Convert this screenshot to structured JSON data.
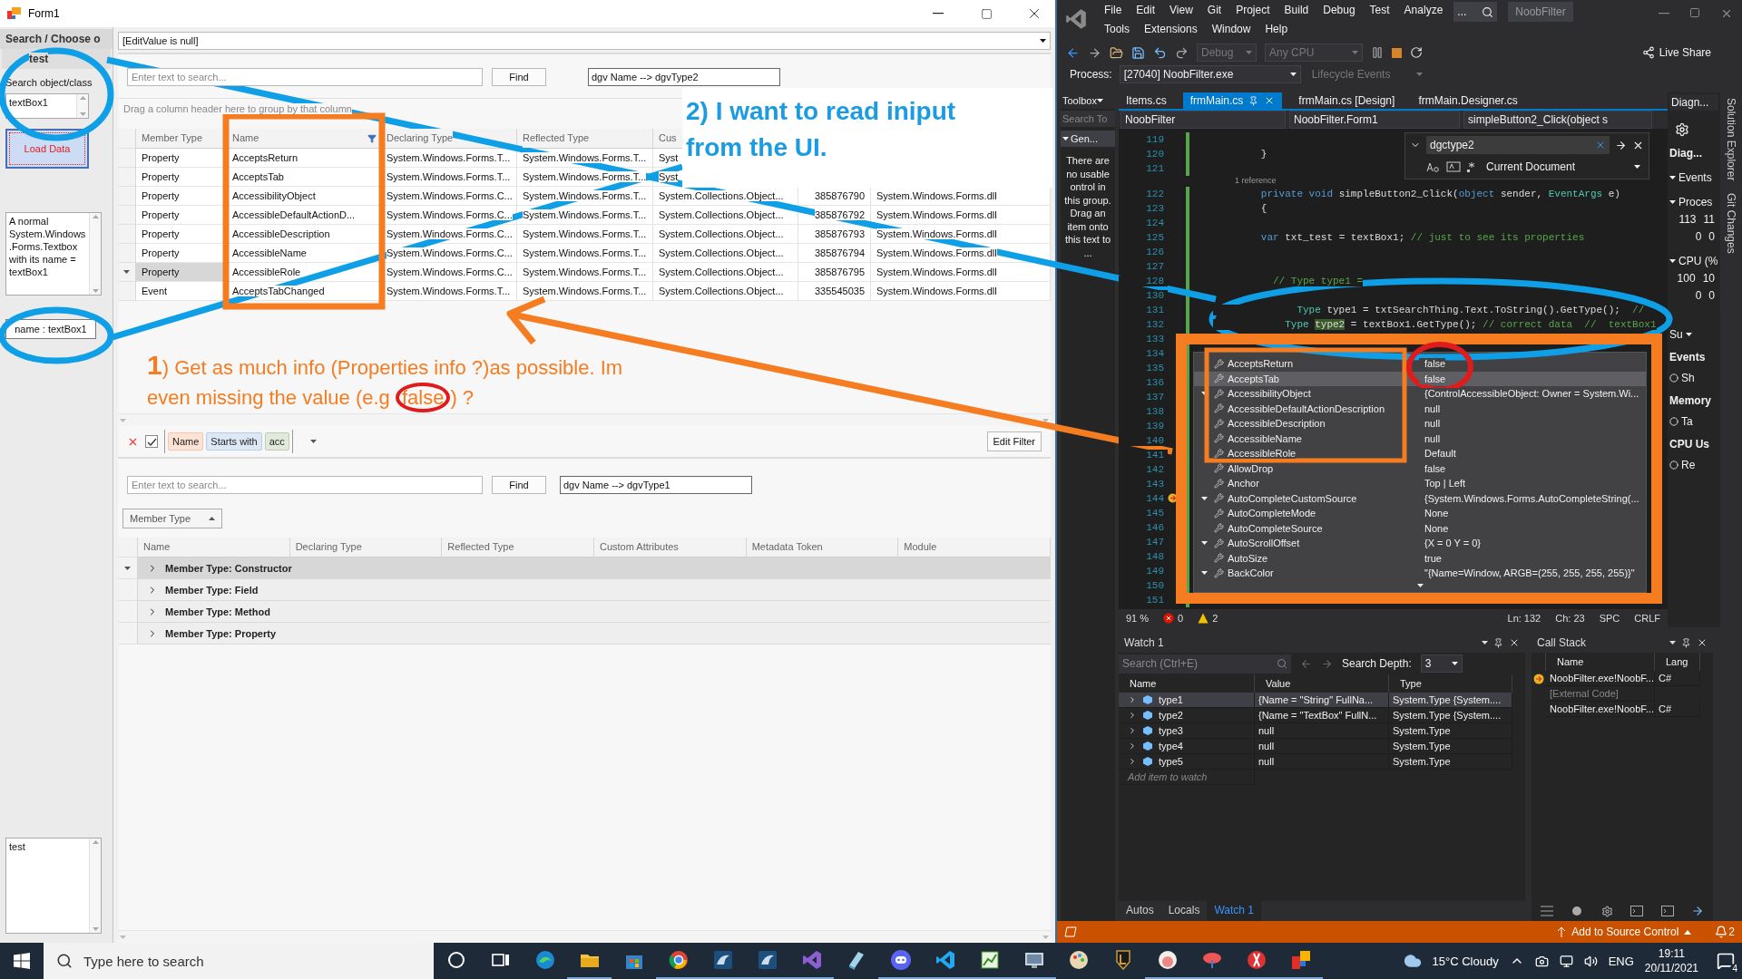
{
  "form": {
    "title": "Form1",
    "sidebar": {
      "header": "Search / Choose o",
      "group": "test",
      "search_label": "Search object/class",
      "search_value": "textBox1",
      "load_button": "Load Data",
      "description": "A normal System.Windows .Forms.Textbox with its name = textBox1",
      "name_field": "name : textBox1",
      "notes": "test"
    },
    "edit_value": "[EditValue is null]",
    "top": {
      "search_placeholder": "Enter text to search...",
      "find": "Find",
      "dgv_label": "dgv Name --> dgvType2",
      "group_panel": "Drag a column header here to group by that column",
      "columns": [
        {
          "label": "Member Type",
          "filtered": false
        },
        {
          "label": "Name",
          "filtered": true
        },
        {
          "label": "Declaring Type",
          "filtered": false
        },
        {
          "label": "Reflected Type",
          "filtered": false
        },
        {
          "label": "Cus"
        }
      ],
      "rows": [
        {
          "member_type": "Property",
          "name": "AcceptsReturn",
          "declaring_type": "System.Windows.Forms.T...",
          "reflected_type": "System.Windows.Forms.T...",
          "custom_attributes": "Syst",
          "selected": false
        },
        {
          "member_type": "Property",
          "name": "AcceptsTab",
          "declaring_type": "System.Windows.Forms.T...",
          "reflected_type": "System.Windows.Forms.T...",
          "custom_attributes": "Syst",
          "selected": false
        },
        {
          "member_type": "Property",
          "name": "AccessibilityObject",
          "declaring_type": "System.Windows.Forms.C...",
          "reflected_type": "System.Windows.Forms.T...",
          "custom_attributes": "System.Collections.Object...",
          "metadata_token": "385876790",
          "module": "System.Windows.Forms.dll",
          "selected": false
        },
        {
          "member_type": "Property",
          "name": "AccessibleDefaultActionD...",
          "declaring_type": "System.Windows.Forms.C...",
          "reflected_type": "System.Windows.Forms.T...",
          "custom_attributes": "System.Collections.Object...",
          "metadata_token": "385876792",
          "module": "System.Windows.Forms.dll",
          "selected": false
        },
        {
          "member_type": "Property",
          "name": "AccessibleDescription",
          "declaring_type": "System.Windows.Forms.C...",
          "reflected_type": "System.Windows.Forms.T...",
          "custom_attributes": "System.Collections.Object...",
          "metadata_token": "385876793",
          "module": "System.Windows.Forms.dll",
          "selected": false
        },
        {
          "member_type": "Property",
          "name": "AccessibleName",
          "declaring_type": "System.Windows.Forms.C...",
          "reflected_type": "System.Windows.Forms.T...",
          "custom_attributes": "System.Collections.Object...",
          "metadata_token": "385876794",
          "module": "System.Windows.Forms.dll",
          "selected": false
        },
        {
          "member_type": "Property",
          "name": "AccessibleRole",
          "declaring_type": "System.Windows.Forms.C...",
          "reflected_type": "System.Windows.Forms.T...",
          "custom_attributes": "System.Collections.Object...",
          "metadata_token": "385876795",
          "module": "System.Windows.Forms.dll",
          "selected": true
        },
        {
          "member_type": "Event",
          "name": "AcceptsTabChanged",
          "declaring_type": "System.Windows.Forms.T...",
          "reflected_type": "System.Windows.Forms.T...",
          "custom_attributes": "System.Collections.Object...",
          "metadata_token": "335545035",
          "module": "System.Windows.Forms.dll",
          "selected": false
        }
      ]
    },
    "filter": {
      "enabled": true,
      "field": "Name",
      "operator": "Starts with",
      "value": "acc",
      "edit_button": "Edit Filter"
    },
    "bottom": {
      "search_placeholder": "Enter text to search...",
      "find": "Find",
      "dgv_label": "dgv Name --> dgvType1",
      "group_chip": "Member Type",
      "columns": [
        "Name",
        "Declaring Type",
        "Reflected Type",
        "Custom Attributes",
        "Metadata Token",
        "Module"
      ],
      "groups": [
        {
          "label": "Member Type: Constructor",
          "selected": true
        },
        {
          "label": "Member Type: Field",
          "selected": false
        },
        {
          "label": "Member Type: Method",
          "selected": false
        },
        {
          "label": "Member Type: Property",
          "selected": false
        }
      ]
    }
  },
  "ide": {
    "menu": [
      [
        "File",
        "Edit",
        "View",
        "Git",
        "Project",
        "Build",
        "Debug",
        "Test",
        "Analyze"
      ],
      [
        "Tools",
        "Extensions",
        "Window",
        "Help"
      ]
    ],
    "search": "...",
    "solution": "NoobFilter",
    "config": "Debug",
    "platform": "Any CPU",
    "live_share": "Live Share",
    "process_label": "Process:",
    "process": "[27040] NoobFilter.exe",
    "lifecycle": "Lifecycle Events",
    "toolbox": {
      "title": "Toolbox",
      "search": "Search To",
      "group": "Gen...",
      "message": "There are no usable ontrol in this group. Drag an item onto this text to ..."
    },
    "tabs": [
      {
        "label": "Items.cs",
        "selected": false
      },
      {
        "label": "frmMain.cs",
        "selected": true
      },
      {
        "label": "frmMain.cs [Design]",
        "selected": false
      },
      {
        "label": "frmMain.Designer.cs",
        "selected": false
      }
    ],
    "nav": [
      "NoobFilter",
      "NoobFilter.Form1",
      "simpleButton2_Click(object s"
    ],
    "find": {
      "value": "dgctype2",
      "scope": "Current Document"
    },
    "code": [
      {
        "kind": "line",
        "number": "119",
        "bp": false
      },
      {
        "kind": "line",
        "number": "120",
        "bp": false,
        "segments": [
          {
            "kind": "plain",
            "text": "        }"
          }
        ]
      },
      {
        "kind": "line",
        "number": "121",
        "bp": false
      },
      {
        "kind": "codelens",
        "text": "1 reference"
      },
      {
        "kind": "line",
        "number": "122",
        "bp": false,
        "segments": [
          {
            "kind": "kw",
            "text": "        private void "
          },
          {
            "kind": "plain",
            "text": "simpleButton2_Click("
          },
          {
            "kind": "kw",
            "text": "object "
          },
          {
            "kind": "plain",
            "text": "sender, "
          },
          {
            "kind": "type",
            "text": "EventArgs "
          },
          {
            "kind": "plain",
            "text": "e)"
          }
        ]
      },
      {
        "kind": "line",
        "number": "123",
        "bp": false,
        "segments": [
          {
            "kind": "plain",
            "text": "        {"
          }
        ]
      },
      {
        "kind": "line",
        "number": "124",
        "bp": false
      },
      {
        "kind": "line",
        "number": "125",
        "bp": false,
        "segments": [
          {
            "kind": "kw",
            "text": "        var "
          },
          {
            "kind": "plain",
            "text": "txt_test = textBox1; "
          },
          {
            "kind": "comment",
            "text": "// just to see its properties"
          }
        ]
      },
      {
        "kind": "line",
        "number": "126",
        "bp": false
      },
      {
        "kind": "line",
        "number": "127",
        "bp": false
      },
      {
        "kind": "line",
        "number": "128",
        "bp": false,
        "segments": [
          {
            "kind": "comment",
            "text": "          // Type type1 ="
          }
        ]
      },
      {
        "kind": "line",
        "number": "130",
        "bp": false
      },
      {
        "kind": "line",
        "number": "131",
        "bp": false,
        "segments": [
          {
            "kind": "type",
            "text": "              Type "
          },
          {
            "kind": "plain",
            "text": "type1 = txtSearchThing.Text.ToString().GetType();  "
          },
          {
            "kind": "comment",
            "text": "//"
          }
        ]
      },
      {
        "kind": "line",
        "number": "132",
        "bp": false,
        "segments": [
          {
            "kind": "type",
            "text": "            Type "
          },
          {
            "kind": "hl",
            "text": "type2"
          },
          {
            "kind": "plain",
            "text": " = textBox1.GetType(); "
          },
          {
            "kind": "comment",
            "text": "// correct data  //  textBox1"
          }
        ]
      },
      {
        "kind": "line",
        "number": "133",
        "bp": false
      },
      {
        "kind": "line",
        "number": "134",
        "bp": false
      },
      {
        "kind": "line",
        "number": "135",
        "bp": false
      },
      {
        "kind": "line",
        "number": "136",
        "bp": false
      },
      {
        "kind": "line",
        "number": "137",
        "bp": false
      },
      {
        "kind": "line",
        "number": "138",
        "bp": false
      },
      {
        "kind": "line",
        "number": "139",
        "bp": false
      },
      {
        "kind": "line",
        "number": "140",
        "bp": false
      },
      {
        "kind": "line",
        "number": "141",
        "bp": false
      },
      {
        "kind": "line",
        "number": "142",
        "bp": false
      },
      {
        "kind": "line",
        "number": "143",
        "bp": false
      },
      {
        "kind": "line",
        "number": "144",
        "bp": true
      },
      {
        "kind": "line",
        "number": "145",
        "bp": false
      },
      {
        "kind": "line",
        "number": "146",
        "bp": false
      },
      {
        "kind": "line",
        "number": "147",
        "bp": false
      },
      {
        "kind": "line",
        "number": "148",
        "bp": false
      },
      {
        "kind": "line",
        "number": "149",
        "bp": false
      },
      {
        "kind": "line",
        "number": "150",
        "bp": false
      },
      {
        "kind": "line",
        "number": "151",
        "bp": false
      }
    ],
    "datatip": [
      {
        "name": "AcceptsReturn",
        "value": "false",
        "expandable": false,
        "selected": false
      },
      {
        "name": "AcceptsTab",
        "value": "false",
        "expandable": false,
        "selected": true
      },
      {
        "name": "AccessibilityObject",
        "value": "{ControlAccessibleObject: Owner = System.Wi...",
        "expandable": true,
        "selected": false
      },
      {
        "name": "AccessibleDefaultActionDescription",
        "value": "null",
        "expandable": false,
        "selected": false
      },
      {
        "name": "AccessibleDescription",
        "value": "null",
        "expandable": false,
        "selected": false
      },
      {
        "name": "AccessibleName",
        "value": "null",
        "expandable": false,
        "selected": false
      },
      {
        "name": "AccessibleRole",
        "value": "Default",
        "expandable": false,
        "selected": false
      },
      {
        "name": "AllowDrop",
        "value": "false",
        "expandable": false,
        "selected": false
      },
      {
        "name": "Anchor",
        "value": "Top | Left",
        "expandable": false,
        "selected": false
      },
      {
        "name": "AutoCompleteCustomSource",
        "value": "{System.Windows.Forms.AutoCompleteString(...",
        "expandable": true,
        "selected": false
      },
      {
        "name": "AutoCompleteMode",
        "value": "None",
        "expandable": false,
        "selected": false
      },
      {
        "name": "AutoCompleteSource",
        "value": "None",
        "expandable": false,
        "selected": false
      },
      {
        "name": "AutoScrollOffset",
        "value": "{X = 0 Y = 0}",
        "expandable": true,
        "selected": false
      },
      {
        "name": "AutoSize",
        "value": "true",
        "expandable": false,
        "selected": false
      },
      {
        "name": "BackColor",
        "value": "\"{Name=Window, ARGB=(255, 255, 255, 255)}\"",
        "expandable": true,
        "selected": false
      }
    ],
    "status": {
      "zoom": "91 %",
      "errors": "0",
      "warnings": "2",
      "line": "Ln: 132",
      "col": "Ch: 23",
      "spc": "SPC",
      "eol": "CRLF"
    },
    "diagnostics": [
      {
        "kind": "title",
        "text": "Diagn..."
      },
      {
        "kind": "session",
        "text": "Diag..."
      },
      {
        "kind": "section",
        "text": "Events"
      },
      {
        "kind": "section",
        "text": "Proces"
      },
      {
        "kind": "pair",
        "values": [
          "113",
          "11"
        ]
      },
      {
        "kind": "pair",
        "values": [
          "0",
          "0"
        ]
      },
      {
        "kind": "section",
        "text": "CPU (%"
      },
      {
        "kind": "pair",
        "values": [
          "100",
          "10"
        ]
      },
      {
        "kind": "pair",
        "values": [
          "0",
          "0"
        ]
      },
      {
        "kind": "tab",
        "text": "Su"
      },
      {
        "kind": "header",
        "text": "Events"
      },
      {
        "kind": "item",
        "text": "Sh"
      },
      {
        "kind": "header",
        "text": "Memory"
      },
      {
        "kind": "item",
        "text": "Ta"
      },
      {
        "kind": "header",
        "text": "CPU Us"
      },
      {
        "kind": "item",
        "text": "Re"
      }
    ],
    "side_tabs": [
      "Solution Explorer",
      "Git Changes"
    ],
    "watch": {
      "title": "Watch 1",
      "search_placeholder": "Search (Ctrl+E)",
      "depth_label": "Search Depth:",
      "depth": "3",
      "columns": [
        "Name",
        "Value",
        "Type"
      ],
      "rows": [
        {
          "name": "type1",
          "value": "{Name = \"String\" FullNa...",
          "type": "System.Type {System....",
          "selected": true
        },
        {
          "name": "type2",
          "value": "{Name = \"TextBox\" FullN...",
          "type": "System.Type {System....",
          "selected": false
        },
        {
          "name": "type3",
          "value": "null",
          "type": "System.Type",
          "selected": false
        },
        {
          "name": "type4",
          "value": "null",
          "type": "System.Type",
          "selected": false
        },
        {
          "name": "type5",
          "value": "null",
          "type": "System.Type",
          "selected": false
        }
      ],
      "add_placeholder": "Add item to watch",
      "tabs": [
        {
          "label": "Autos",
          "selected": false
        },
        {
          "label": "Locals",
          "selected": false
        },
        {
          "label": "Watch 1",
          "selected": true
        }
      ]
    },
    "callstack": {
      "title": "Call Stack",
      "columns": [
        "Name",
        "Lang"
      ],
      "rows": [
        {
          "name": "NoobFilter.exe!NoobF...",
          "lang": "C#",
          "current": true,
          "external": false
        },
        {
          "name": "[External Code]",
          "current": false,
          "external": true
        },
        {
          "name": "NoobFilter.exe!NoobF...",
          "lang": "C#",
          "current": false,
          "external": false
        }
      ]
    },
    "statusbar": {
      "source_control": "Add to Source Control",
      "notifications": "2"
    }
  },
  "taskbar": {
    "search_placeholder": "Type here to search",
    "weather": "15°C  Cloudy",
    "language": "ENG",
    "time": "19:11",
    "date": "20/11/2021",
    "notifications": "4"
  },
  "annotations": {
    "note_ui": "2) I want to read iniput from the UI.",
    "note_info": {
      "number": "1",
      "text": ") Get as much info (Properties info ?)as possible. Im even missing the value (e.g ",
      "circled": "false",
      "end": ") ?"
    }
  }
}
